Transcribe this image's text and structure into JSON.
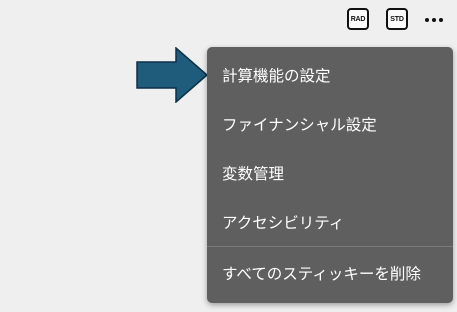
{
  "toolbar": {
    "rad_label": "RAD",
    "std_label": "STD",
    "more_icon": "more-horizontal-icon"
  },
  "annotation": {
    "arrow_icon": "pointer-arrow-icon",
    "arrow_color": "#1f5b7a"
  },
  "menu": {
    "background": "#5f5f5f",
    "items": [
      {
        "label": "計算機能の設定"
      },
      {
        "label": "ファイナンシャル設定"
      },
      {
        "label": "変数管理"
      },
      {
        "label": "アクセシビリティ"
      },
      {
        "label": "すべてのスティッキーを削除"
      }
    ]
  }
}
